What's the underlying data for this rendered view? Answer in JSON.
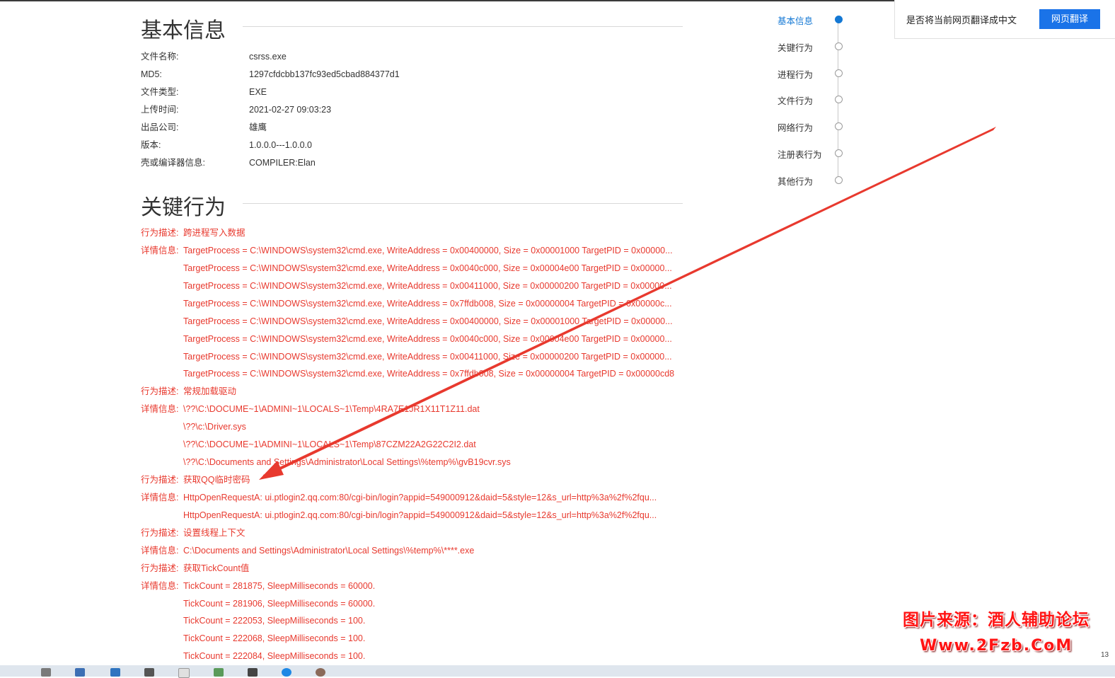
{
  "basic": {
    "title": "基本信息",
    "rows": [
      {
        "label": "文件名称:",
        "value": "csrss.exe"
      },
      {
        "label": "MD5:",
        "value": "1297cfdcbb137fc93ed5cbad884377d1"
      },
      {
        "label": "文件类型:",
        "value": "EXE"
      },
      {
        "label": "上传时间:",
        "value": "2021-02-27 09:03:23"
      },
      {
        "label": "出品公司:",
        "value": "雄鹰"
      },
      {
        "label": "版本:",
        "value": "1.0.0.0---1.0.0.0"
      },
      {
        "label": "壳或编译器信息:",
        "value": "COMPILER:Elan"
      }
    ]
  },
  "key": {
    "title": "关键行为",
    "rows": [
      {
        "label": "行为描述:",
        "text": "跨进程写入数据"
      },
      {
        "label": "详情信息:",
        "text": "TargetProcess = C:\\WINDOWS\\system32\\cmd.exe, WriteAddress = 0x00400000, Size = 0x00001000 TargetPID = 0x00000..."
      },
      {
        "label": "",
        "text": "TargetProcess = C:\\WINDOWS\\system32\\cmd.exe, WriteAddress = 0x0040c000, Size = 0x00004e00 TargetPID = 0x00000..."
      },
      {
        "label": "",
        "text": "TargetProcess = C:\\WINDOWS\\system32\\cmd.exe, WriteAddress = 0x00411000, Size = 0x00000200 TargetPID = 0x00000..."
      },
      {
        "label": "",
        "text": "TargetProcess = C:\\WINDOWS\\system32\\cmd.exe, WriteAddress = 0x7ffdb008, Size = 0x00000004 TargetPID = 0x00000c..."
      },
      {
        "label": "",
        "text": "TargetProcess = C:\\WINDOWS\\system32\\cmd.exe, WriteAddress = 0x00400000, Size = 0x00001000 TargetPID = 0x00000..."
      },
      {
        "label": "",
        "text": "TargetProcess = C:\\WINDOWS\\system32\\cmd.exe, WriteAddress = 0x0040c000, Size = 0x00004e00 TargetPID = 0x00000..."
      },
      {
        "label": "",
        "text": "TargetProcess = C:\\WINDOWS\\system32\\cmd.exe, WriteAddress = 0x00411000, Size = 0x00000200 TargetPID = 0x00000..."
      },
      {
        "label": "",
        "text": "TargetProcess = C:\\WINDOWS\\system32\\cmd.exe, WriteAddress = 0x7ffdb008, Size = 0x00000004 TargetPID = 0x00000cd8"
      },
      {
        "label": "行为描述:",
        "text": "常规加载驱动"
      },
      {
        "label": "详情信息:",
        "text": "\\??\\C:\\DOCUME~1\\ADMINI~1\\LOCALS~1\\Temp\\4RA7E1JR1X11T1Z11.dat"
      },
      {
        "label": "",
        "text": "\\??\\c:\\Driver.sys"
      },
      {
        "label": "",
        "text": "\\??\\C:\\DOCUME~1\\ADMINI~1\\LOCALS~1\\Temp\\87CZM22A2G22C2I2.dat"
      },
      {
        "label": "",
        "text": "\\??\\C:\\Documents and Settings\\Administrator\\Local Settings\\%temp%\\gvB19cvr.sys"
      },
      {
        "label": "行为描述:",
        "text": "获取QQ临时密码"
      },
      {
        "label": "详情信息:",
        "text": "HttpOpenRequestA: ui.ptlogin2.qq.com:80/cgi-bin/login?appid=549000912&daid=5&style=12&s_url=http%3a%2f%2fqu..."
      },
      {
        "label": "",
        "text": "HttpOpenRequestA: ui.ptlogin2.qq.com:80/cgi-bin/login?appid=549000912&daid=5&style=12&s_url=http%3a%2f%2fqu..."
      },
      {
        "label": "行为描述:",
        "text": "设置线程上下文"
      },
      {
        "label": "详情信息:",
        "text": "C:\\Documents and Settings\\Administrator\\Local Settings\\%temp%\\****.exe"
      },
      {
        "label": "行为描述:",
        "text": "获取TickCount值"
      },
      {
        "label": "详情信息:",
        "text": "TickCount = 281875, SleepMilliseconds = 60000."
      },
      {
        "label": "",
        "text": "TickCount = 281906, SleepMilliseconds = 60000."
      },
      {
        "label": "",
        "text": "TickCount = 222053, SleepMilliseconds = 100."
      },
      {
        "label": "",
        "text": "TickCount = 222068, SleepMilliseconds = 100."
      },
      {
        "label": "",
        "text": "TickCount = 222084, SleepMilliseconds = 100."
      }
    ]
  },
  "nav": {
    "items": [
      {
        "label": "基本信息",
        "active": true
      },
      {
        "label": "关键行为",
        "active": false
      },
      {
        "label": "进程行为",
        "active": false
      },
      {
        "label": "文件行为",
        "active": false
      },
      {
        "label": "网络行为",
        "active": false
      },
      {
        "label": "注册表行为",
        "active": false
      },
      {
        "label": "其他行为",
        "active": false
      }
    ]
  },
  "translate": {
    "prompt": "是否将当前网页翻译成中文",
    "button": "网页翻译"
  },
  "watermark": {
    "line1": "图片来源：酒人辅助论坛",
    "line2": "Www.2Fzb.CoM"
  },
  "corner_text": "13",
  "colors": {
    "behavior_text": "#e8392e",
    "nav_active": "#1478d4",
    "translate_button": "#1a73e8",
    "arrow": "#e8392e",
    "watermark": "#ff1414"
  }
}
